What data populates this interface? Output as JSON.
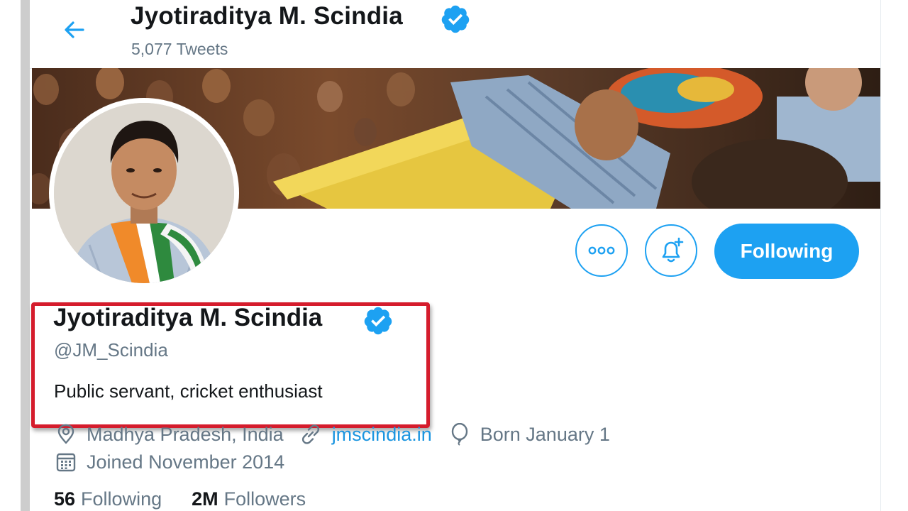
{
  "header": {
    "title": "Jyotiraditya M. Scindia",
    "tweet_count": "5,077 Tweets"
  },
  "profile": {
    "display_name": "Jyotiraditya M. Scindia",
    "handle": "@JM_Scindia",
    "bio": "Public servant, cricket enthusiast",
    "verified": true
  },
  "meta": {
    "location": "Madhya Pradesh, India",
    "website": "jmscindia.in",
    "birthday": "Born January 1",
    "joined": "Joined November 2014"
  },
  "actions": {
    "follow_label": "Following"
  },
  "stats": {
    "following_count": "56",
    "following_label": "Following",
    "followers_count": "2M",
    "followers_label": "Followers"
  },
  "icons": {
    "back": "arrow-left-icon",
    "more": "more-options-icon",
    "bell": "notification-bell-icon",
    "verified": "verified-badge-icon",
    "location": "location-pin-icon",
    "link": "link-icon",
    "birthday": "balloon-icon",
    "calendar": "calendar-icon"
  },
  "colors": {
    "accent": "#1da1f2",
    "link": "#1b95e0",
    "secondary_text": "#657786",
    "highlight": "#d51c2c"
  }
}
